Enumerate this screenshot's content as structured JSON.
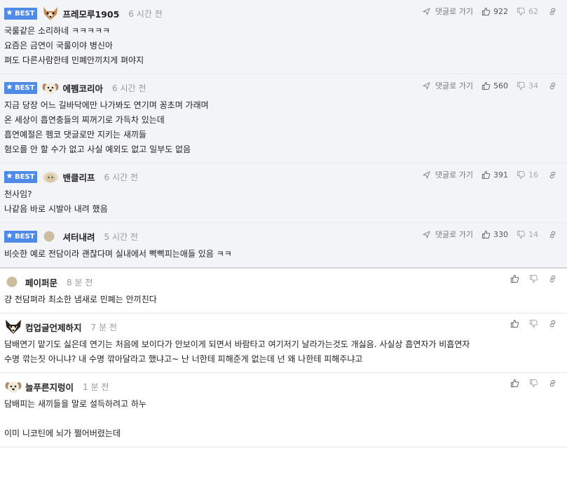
{
  "labels": {
    "best": "BEST",
    "reply": "댓글로 가기"
  },
  "comments": [
    {
      "best": true,
      "avatar": "shiba-dog-icon",
      "nick": "프레모루1905",
      "time": "6 시간 전",
      "likes": "922",
      "dislikes": "62",
      "lines": [
        "국룰같은 소리하네 ㅋㅋㅋㅋㅋ",
        "요즘은 금연이 국룰이야 병신아",
        "펴도 다른사람한테 민폐안끼치게 펴야지"
      ]
    },
    {
      "best": true,
      "avatar": "puppy-icon",
      "nick": "에펨코리아",
      "time": "6 시간 전",
      "likes": "560",
      "dislikes": "34",
      "lines": [
        "지금 당장 어느 길바닥에만 나가봐도 연기며 꽁초며 가래며",
        "온 세상이 흡연충들의 찌꺼기로 가득차 있는데",
        "흡연예절은 펨코 댓글로만 지키는 새끼들",
        "혐오를 안 할 수가 없고 사실 예외도 없고 일부도 없음"
      ]
    },
    {
      "best": true,
      "avatar": "sheep-icon",
      "nick": "밴클리프",
      "time": "6 시간 전",
      "likes": "391",
      "dislikes": "16",
      "lines": [
        "천사임?",
        "나같음 바로 시발아 내려 했음"
      ]
    },
    {
      "best": true,
      "avatar": "round-icon",
      "nick": "셔터내려",
      "time": "5 시간 전",
      "likes": "330",
      "dislikes": "14",
      "lines": [
        "비슷한 예로 전담이라 괜찮다며 실내에서 뻑뻑피는애들 있음 ㅋㅋ"
      ]
    },
    {
      "best": false,
      "avatar": "round-icon",
      "nick": "페이퍼문",
      "time": "8 분 전",
      "lines": [
        "걍 전담펴라 최소한 냄새로 민폐는 안끼친다"
      ]
    },
    {
      "best": false,
      "avatar": "fox-icon",
      "nick": "컴업글언제하지",
      "time": "7 분 전",
      "lines": [
        "담배연기 맡기도 싫은데 연기는 처음에 보이다가 안보이게 되면서 바람타고 여기저기 날라가는것도 개싫음. 사실상 흡연자가 비흡연자",
        "수명 깎는짓 아니냐? 내 수명 깎아달라고 했냐고~ 난 너한테 피해준게 없는데 넌 왜 나한테 피해주냐고"
      ]
    },
    {
      "best": false,
      "avatar": "puppy-icon",
      "nick": "늘푸른지렁이",
      "time": "1 분 전",
      "lines": [
        "담배피는 새끼들을 말로 설득하려고 하누",
        "",
        "이미 니코틴에 뇌가 쩔어버렸는데"
      ]
    }
  ]
}
